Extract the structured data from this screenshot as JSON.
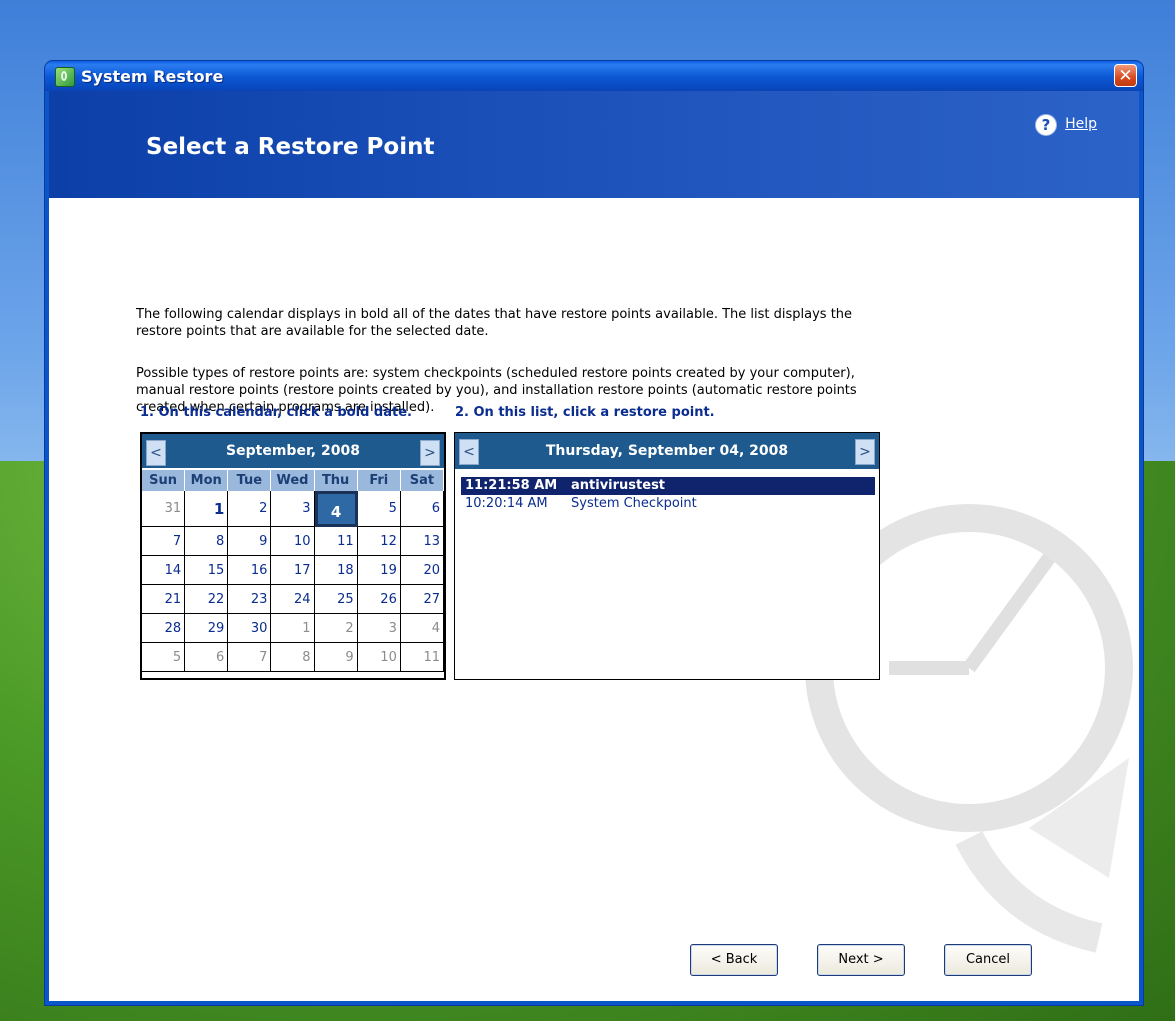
{
  "window": {
    "title": "System Restore",
    "close_glyph": "✕"
  },
  "header": {
    "title": "Select a Restore Point",
    "help_label": "Help",
    "help_glyph": "?"
  },
  "intro": {
    "p1": "The following calendar displays in bold all of the dates that have restore points available. The list displays the restore points that are available for the selected date.",
    "p2": "Possible types of restore points are: system checkpoints (scheduled restore points created by your computer), manual restore points (restore points created by you), and installation restore points (automatic restore points created when certain programs are installed)."
  },
  "steps": {
    "step1": "1. On this calendar, click a bold date.",
    "step2": "2. On this list, click a restore point."
  },
  "calendar": {
    "month_title": "September, 2008",
    "prev": "<",
    "next": ">",
    "weekdays": [
      "Sun",
      "Mon",
      "Tue",
      "Wed",
      "Thu",
      "Fri",
      "Sat"
    ],
    "weeks": [
      [
        {
          "d": "31",
          "o": true
        },
        {
          "d": "1",
          "b": true
        },
        {
          "d": "2"
        },
        {
          "d": "3"
        },
        {
          "d": "4",
          "s": true
        },
        {
          "d": "5"
        },
        {
          "d": "6"
        }
      ],
      [
        {
          "d": "7"
        },
        {
          "d": "8"
        },
        {
          "d": "9"
        },
        {
          "d": "10"
        },
        {
          "d": "11"
        },
        {
          "d": "12"
        },
        {
          "d": "13"
        }
      ],
      [
        {
          "d": "14"
        },
        {
          "d": "15"
        },
        {
          "d": "16"
        },
        {
          "d": "17"
        },
        {
          "d": "18"
        },
        {
          "d": "19"
        },
        {
          "d": "20"
        }
      ],
      [
        {
          "d": "21"
        },
        {
          "d": "22"
        },
        {
          "d": "23"
        },
        {
          "d": "24"
        },
        {
          "d": "25"
        },
        {
          "d": "26"
        },
        {
          "d": "27"
        }
      ],
      [
        {
          "d": "28"
        },
        {
          "d": "29"
        },
        {
          "d": "30"
        },
        {
          "d": "1",
          "o": true
        },
        {
          "d": "2",
          "o": true
        },
        {
          "d": "3",
          "o": true
        },
        {
          "d": "4",
          "o": true
        }
      ],
      [
        {
          "d": "5",
          "o": true
        },
        {
          "d": "6",
          "o": true
        },
        {
          "d": "7",
          "o": true
        },
        {
          "d": "8",
          "o": true
        },
        {
          "d": "9",
          "o": true
        },
        {
          "d": "10",
          "o": true
        },
        {
          "d": "11",
          "o": true
        }
      ]
    ]
  },
  "restore_list": {
    "date_title": "Thursday, September 04, 2008",
    "prev": "<",
    "next": ">",
    "items": [
      {
        "time": "11:21:58 AM",
        "name": "antivirustest",
        "selected": true
      },
      {
        "time": "10:20:14 AM",
        "name": "System Checkpoint",
        "selected": false
      }
    ]
  },
  "buttons": {
    "back": "< Back",
    "next": "Next >",
    "cancel": "Cancel"
  }
}
